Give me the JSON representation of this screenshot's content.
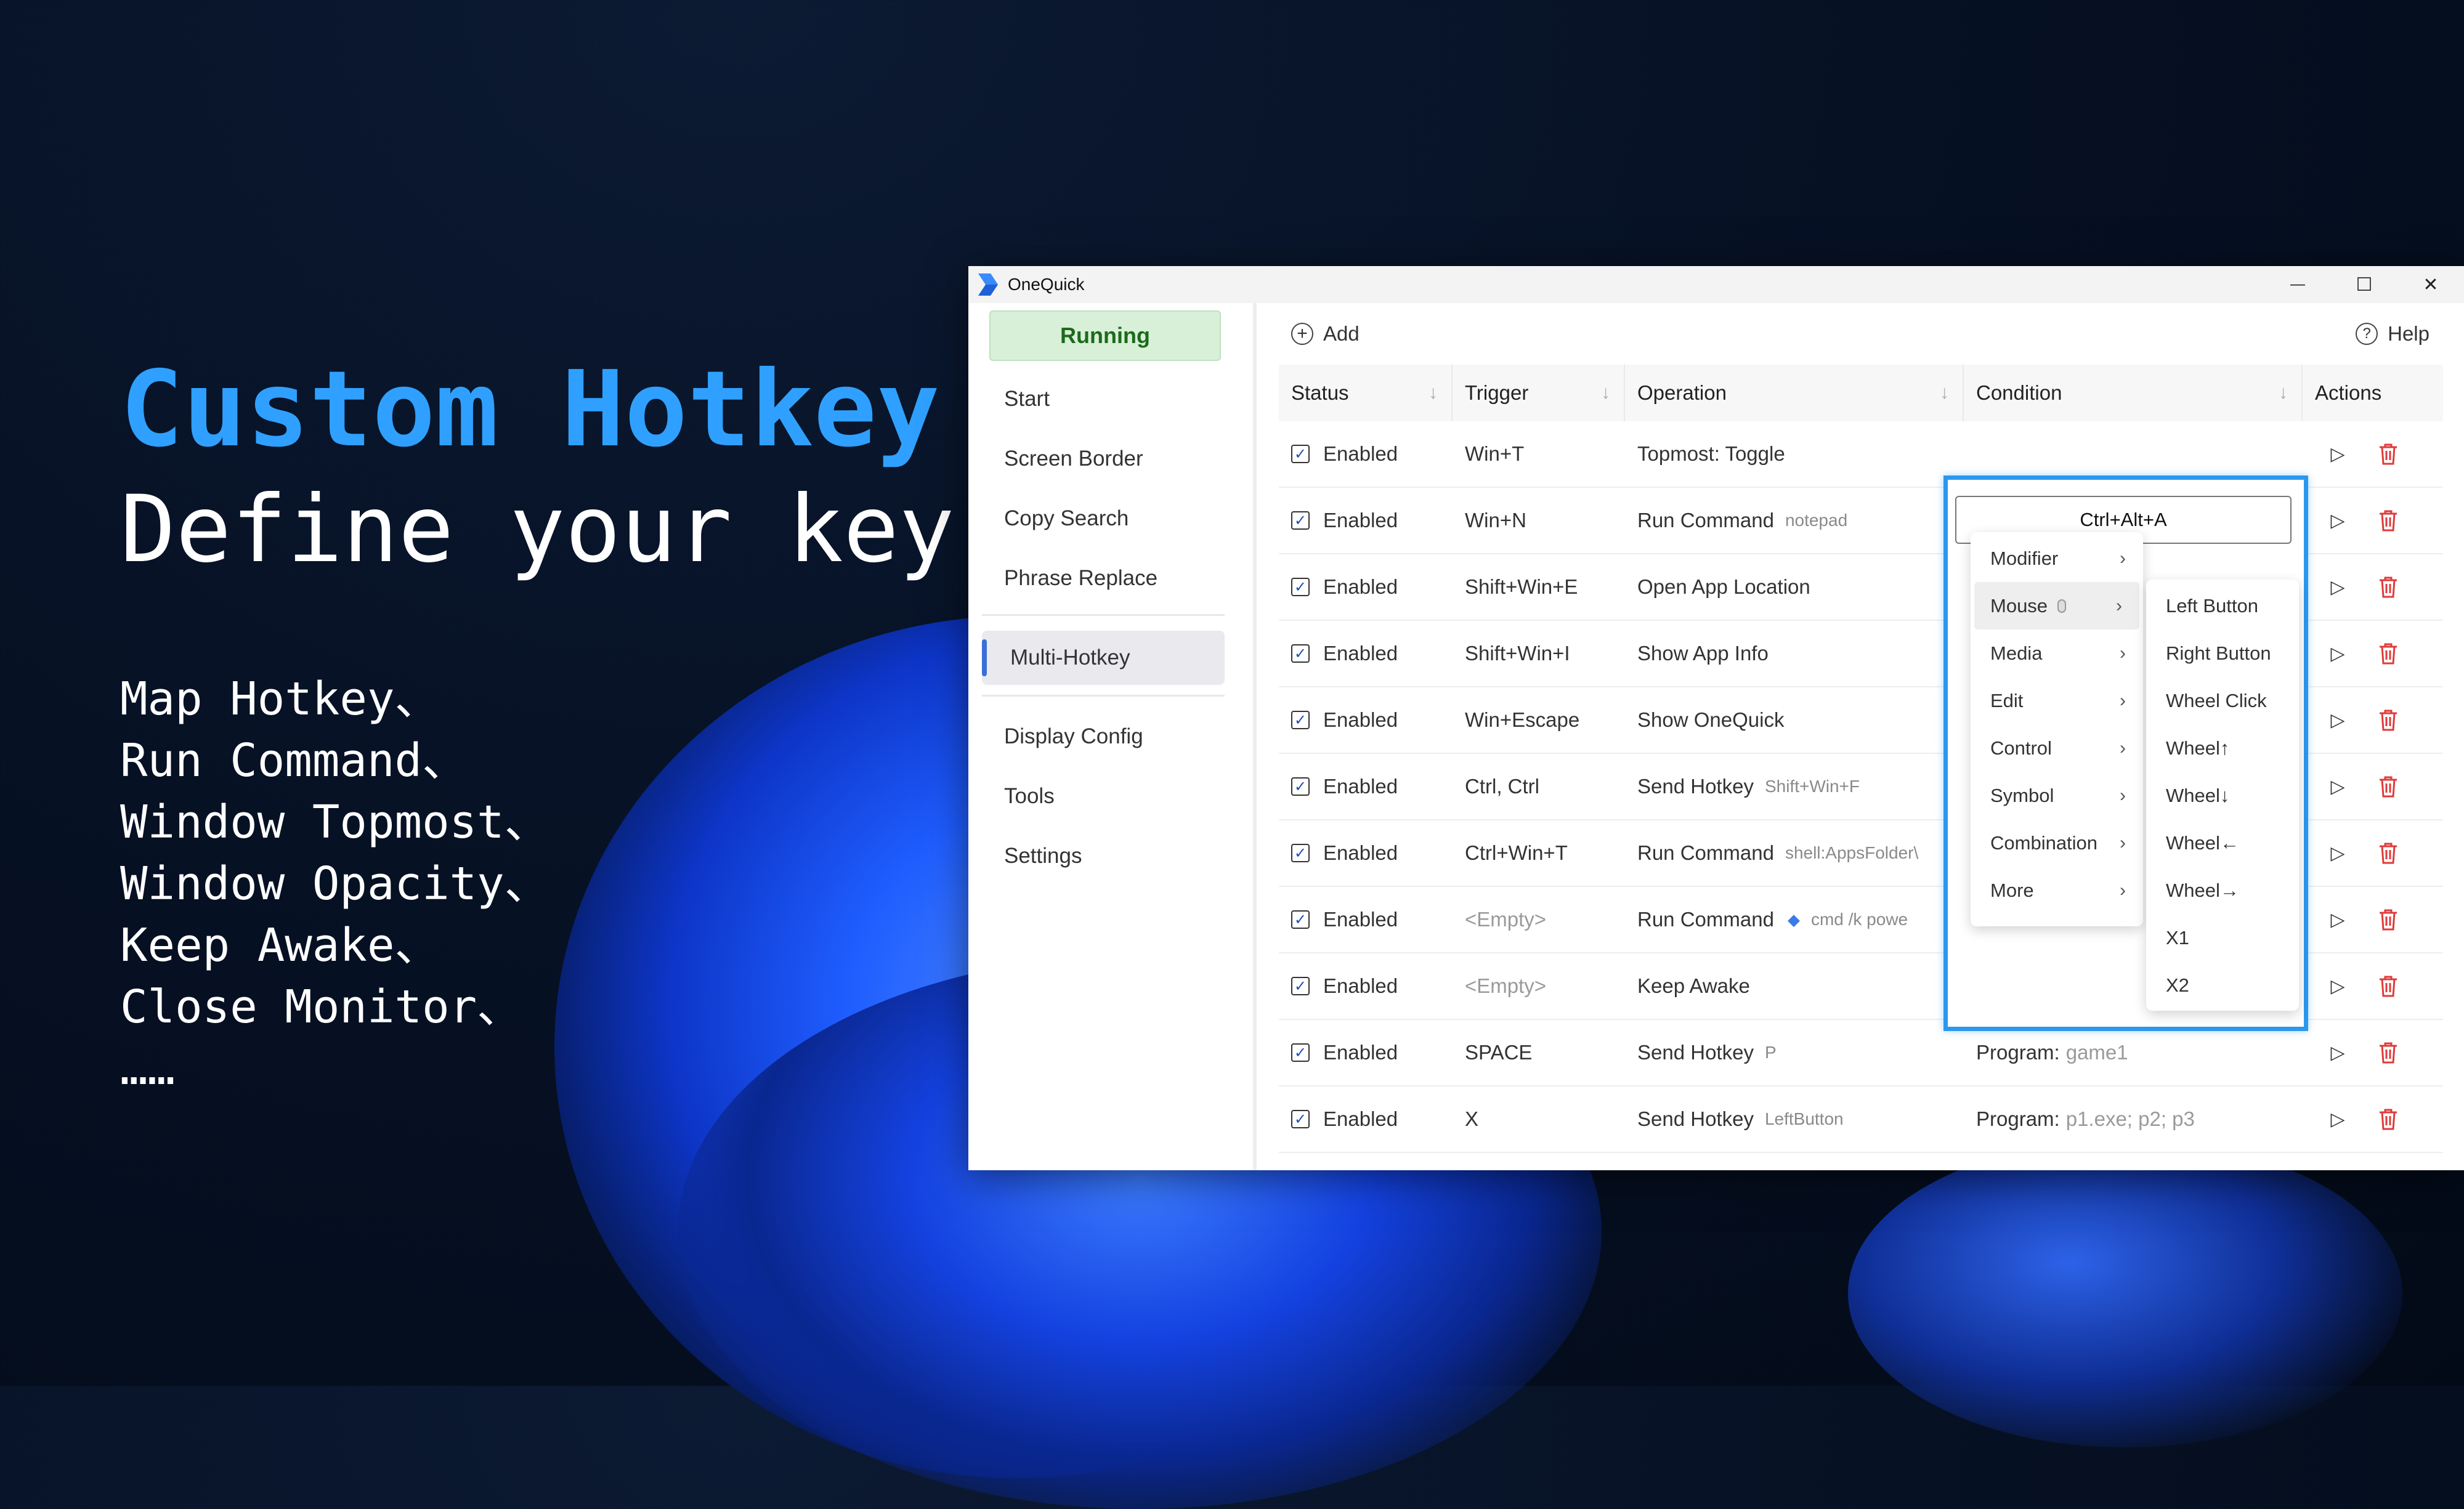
{
  "hero": {
    "title": "Custom Hotkey",
    "subtitle": "Define your key",
    "features": [
      "Map Hotkey、",
      "Run Command、",
      "Window Topmost、",
      "Window Opacity、",
      "Keep Awake、",
      "Close Monitor、",
      "……"
    ]
  },
  "window": {
    "title": "OneQuick",
    "controls": {
      "minimize": "—",
      "maximize": "☐",
      "close": "✕"
    }
  },
  "sidebar": {
    "status_label": "Running",
    "items": [
      "Start",
      "Screen Border",
      "Copy Search",
      "Phrase Replace",
      "Multi-Hotkey",
      "Display Config",
      "Tools",
      "Settings"
    ],
    "active": "Multi-Hotkey"
  },
  "toolbar": {
    "add_label": "Add",
    "help_label": "Help"
  },
  "table": {
    "columns": [
      "Status",
      "Trigger",
      "Operation",
      "Condition",
      "Actions"
    ],
    "rows": [
      {
        "status": "Enabled",
        "trigger": "Win+T",
        "operation": "Topmost: Toggle",
        "detail": "",
        "condition_label": "",
        "condition_value": ""
      },
      {
        "status": "Enabled",
        "trigger": "Win+N",
        "operation": "Run Command",
        "detail": "notepad",
        "condition_label": "",
        "condition_value": ""
      },
      {
        "status": "Enabled",
        "trigger": "Shift+Win+E",
        "operation": "Open App Location",
        "detail": "",
        "condition_label": "",
        "condition_value": ""
      },
      {
        "status": "Enabled",
        "trigger": "Shift+Win+I",
        "operation": "Show App Info",
        "detail": "",
        "condition_label": "",
        "condition_value": ""
      },
      {
        "status": "Enabled",
        "trigger": "Win+Escape",
        "operation": "Show OneQuick",
        "detail": "",
        "condition_label": "",
        "condition_value": ""
      },
      {
        "status": "Enabled",
        "trigger": "Ctrl, Ctrl",
        "operation": "Send Hotkey",
        "detail": "Shift+Win+F",
        "condition_label": "",
        "condition_value": ""
      },
      {
        "status": "Enabled",
        "trigger": "Ctrl+Win+T",
        "operation": "Run Command",
        "detail": "shell:AppsFolder\\",
        "condition_label": "",
        "condition_value": ""
      },
      {
        "status": "Enabled",
        "trigger": "<Empty>",
        "operation": "Run Command",
        "detail": "cmd /k powe",
        "condition_label": "",
        "condition_value": ""
      },
      {
        "status": "Enabled",
        "trigger": "<Empty>",
        "operation": "Keep Awake",
        "detail": "",
        "condition_label": "",
        "condition_value": ""
      },
      {
        "status": "Enabled",
        "trigger": "SPACE",
        "operation": "Send Hotkey",
        "detail": "P",
        "condition_label": "Program:",
        "condition_value": "game1"
      },
      {
        "status": "Enabled",
        "trigger": "X",
        "operation": "Send Hotkey",
        "detail": "LeftButton",
        "condition_label": "Program:",
        "condition_value": "p1.exe; p2; p3"
      }
    ]
  },
  "popup": {
    "hotkey_value": "Ctrl+Alt+A",
    "menu": [
      "Modifier",
      "Mouse",
      "Media",
      "Edit",
      "Control",
      "Symbol",
      "Combination",
      "More"
    ],
    "submenu": [
      "Left Button",
      "Right Button",
      "Wheel Click",
      "Wheel↑",
      "Wheel↓",
      "Wheel←",
      "Wheel→",
      "X1",
      "X2"
    ]
  },
  "colors": {
    "accent": "#2fa0ff",
    "running_bg": "#d8f0d8",
    "popup_border": "#2a98ef",
    "delete_red": "#e03a3a"
  }
}
